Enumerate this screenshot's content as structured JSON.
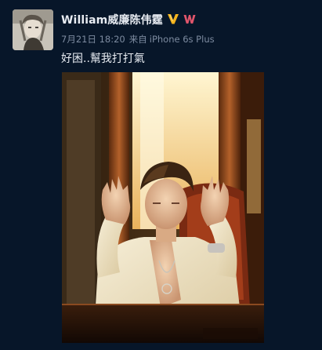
{
  "post": {
    "author": "William威廉陈伟霆",
    "verified_icon": "verified-v-icon",
    "member_icon": "weibo-w-icon",
    "date": "7月21日 18:20",
    "source_prefix": "来自",
    "source": "iPhone 6s Plus",
    "text": "好困..幫我打打氣",
    "colors": {
      "background": "#071629",
      "name": "#e8ecf2",
      "meta": "#7d8ba0",
      "verified": "#f5b41d",
      "member": "#e0556b"
    }
  }
}
